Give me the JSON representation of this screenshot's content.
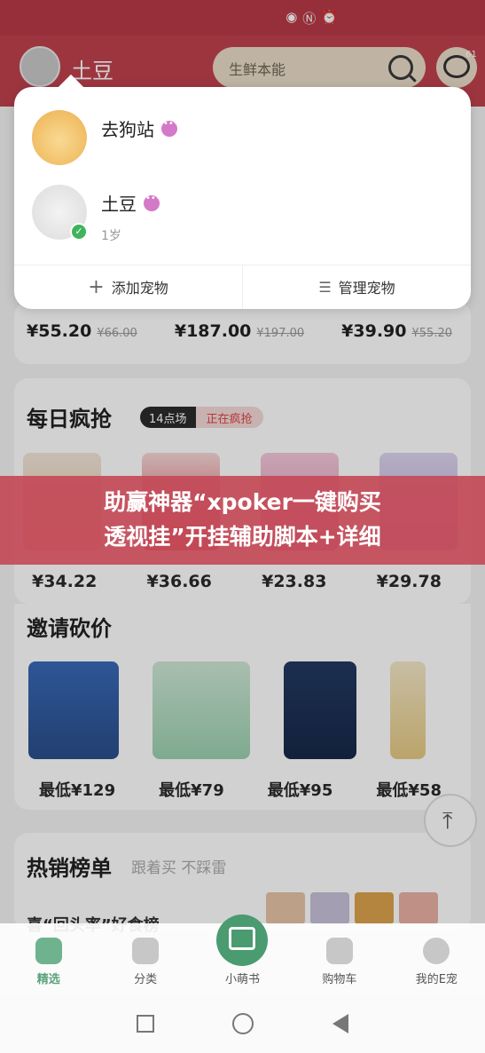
{
  "header": {
    "pet_name": "土豆",
    "search_placeholder": "生鲜本能",
    "msg_badge": "61"
  },
  "pet_popup": {
    "pets": [
      {
        "name": "去狗站",
        "age": ""
      },
      {
        "name": "土豆",
        "age": "1岁"
      }
    ],
    "add_label": "添加宠物",
    "manage_label": "管理宠物"
  },
  "top_prices": [
    {
      "now": "¥55.20",
      "old": "¥66.00"
    },
    {
      "now": "¥187.00",
      "old": "¥197.00"
    },
    {
      "now": "¥39.90",
      "old": "¥55.20"
    }
  ],
  "flash_sale": {
    "title": "每日疯抢",
    "slot_label": "14点场",
    "status_label": "正在疯抢",
    "prices": [
      "¥34.22",
      "¥36.66",
      "¥23.83",
      "¥29.78"
    ]
  },
  "banner": {
    "line1": "助赢神器“xpoker一键购买",
    "line2": "透视挂”开挂辅助脚本+详细"
  },
  "bargain": {
    "title": "邀请砍价",
    "prices": [
      "最低¥129",
      "最低¥79",
      "最低¥95",
      "最低¥58"
    ]
  },
  "hot": {
    "title": "热销榜单",
    "subtitle": "跟着买 不踩雷",
    "item_title": "喜“回头率”好食榜"
  },
  "bottom_nav": [
    {
      "label": "精选",
      "icon": "home-icon"
    },
    {
      "label": "分类",
      "icon": "category-icon"
    },
    {
      "label": "小萌书",
      "icon": "book-icon"
    },
    {
      "label": "购物车",
      "icon": "cart-icon"
    },
    {
      "label": "我的E宠",
      "icon": "profile-icon"
    }
  ],
  "colors": {
    "header_red": "#c0414d",
    "accent_green": "#4a9b70",
    "search_bg": "#e9dcc9"
  }
}
